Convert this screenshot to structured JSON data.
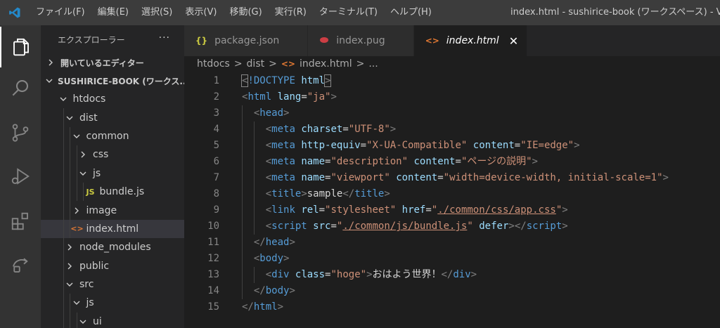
{
  "window": {
    "title": "index.html - sushirice-book (ワークスペース) - Visu"
  },
  "menu": [
    {
      "label": "ファイル(F)"
    },
    {
      "label": "編集(E)"
    },
    {
      "label": "選択(S)"
    },
    {
      "label": "表示(V)"
    },
    {
      "label": "移動(G)"
    },
    {
      "label": "実行(R)"
    },
    {
      "label": "ターミナル(T)"
    },
    {
      "label": "ヘルプ(H)"
    }
  ],
  "activitybar": [
    {
      "icon": "files-icon",
      "active": true
    },
    {
      "icon": "search-icon"
    },
    {
      "icon": "source-control-icon"
    },
    {
      "icon": "run-debug-icon"
    },
    {
      "icon": "extensions-icon"
    },
    {
      "icon": "remote-explorer-icon"
    }
  ],
  "explorer": {
    "title": "エクスプローラー",
    "more": "···",
    "sections": {
      "open_editors": "開いているエディター",
      "workspace": "SUSHIRICE-BOOK (ワークス..."
    },
    "tree": [
      {
        "label": "htdocs",
        "type": "folder",
        "expanded": true,
        "depth": 1
      },
      {
        "label": "dist",
        "type": "folder",
        "expanded": true,
        "depth": 2
      },
      {
        "label": "common",
        "type": "folder",
        "expanded": true,
        "depth": 3
      },
      {
        "label": "css",
        "type": "folder",
        "expanded": false,
        "depth": 4
      },
      {
        "label": "js",
        "type": "folder",
        "expanded": true,
        "depth": 4
      },
      {
        "label": "bundle.js",
        "type": "file",
        "icon": "JS",
        "depth": 5
      },
      {
        "label": "image",
        "type": "folder",
        "expanded": false,
        "depth": 3
      },
      {
        "label": "index.html",
        "type": "file",
        "icon": "<>",
        "depth": 3,
        "selected": true
      },
      {
        "label": "node_modules",
        "type": "folder",
        "expanded": false,
        "depth": 2
      },
      {
        "label": "public",
        "type": "folder",
        "expanded": false,
        "depth": 2
      },
      {
        "label": "src",
        "type": "folder",
        "expanded": true,
        "depth": 2
      },
      {
        "label": "js",
        "type": "folder",
        "expanded": true,
        "depth": 3
      },
      {
        "label": "ui",
        "type": "folder",
        "expanded": true,
        "depth": 4
      }
    ]
  },
  "tabs": [
    {
      "label": "package.json",
      "icon": "{}",
      "icon_color": "#cbcb41"
    },
    {
      "label": "index.pug",
      "icon": "pug",
      "icon_color": "#cc3e44"
    },
    {
      "label": "index.html",
      "icon": "<>",
      "icon_color": "#e37933",
      "active": true,
      "close": "✕"
    }
  ],
  "breadcrumb": {
    "parts": [
      "htdocs",
      "dist",
      "index.html",
      "..."
    ],
    "sep": ">"
  },
  "editor": {
    "lines": [
      {
        "n": "1",
        "indent": 0,
        "tokens": [
          [
            "brk",
            "<"
          ],
          [
            "tag",
            "!DOCTYPE"
          ],
          [
            "txt",
            " "
          ],
          [
            "attr",
            "html"
          ],
          [
            "brk",
            ">"
          ]
        ]
      },
      {
        "n": "2",
        "indent": 0,
        "tokens": [
          [
            "brk",
            "<"
          ],
          [
            "tag",
            "html"
          ],
          [
            "txt",
            " "
          ],
          [
            "attr",
            "lang"
          ],
          [
            "txt",
            "="
          ],
          [
            "str",
            "\"ja\""
          ],
          [
            "brk",
            ">"
          ]
        ]
      },
      {
        "n": "3",
        "indent": 1,
        "tokens": [
          [
            "brk",
            "<"
          ],
          [
            "tag",
            "head"
          ],
          [
            "brk",
            ">"
          ]
        ]
      },
      {
        "n": "4",
        "indent": 2,
        "tokens": [
          [
            "brk",
            "<"
          ],
          [
            "tag",
            "meta"
          ],
          [
            "txt",
            " "
          ],
          [
            "attr",
            "charset"
          ],
          [
            "txt",
            "="
          ],
          [
            "str",
            "\"UTF-8\""
          ],
          [
            "brk",
            ">"
          ]
        ]
      },
      {
        "n": "5",
        "indent": 2,
        "tokens": [
          [
            "brk",
            "<"
          ],
          [
            "tag",
            "meta"
          ],
          [
            "txt",
            " "
          ],
          [
            "attr",
            "http-equiv"
          ],
          [
            "txt",
            "="
          ],
          [
            "str",
            "\"X-UA-Compatible\""
          ],
          [
            "txt",
            " "
          ],
          [
            "attr",
            "content"
          ],
          [
            "txt",
            "="
          ],
          [
            "str",
            "\"IE=edge\""
          ],
          [
            "brk",
            ">"
          ]
        ]
      },
      {
        "n": "6",
        "indent": 2,
        "tokens": [
          [
            "brk",
            "<"
          ],
          [
            "tag",
            "meta"
          ],
          [
            "txt",
            " "
          ],
          [
            "attr",
            "name"
          ],
          [
            "txt",
            "="
          ],
          [
            "str",
            "\"description\""
          ],
          [
            "txt",
            " "
          ],
          [
            "attr",
            "content"
          ],
          [
            "txt",
            "="
          ],
          [
            "str",
            "\"ページの説明\""
          ],
          [
            "brk",
            ">"
          ]
        ]
      },
      {
        "n": "7",
        "indent": 2,
        "tokens": [
          [
            "brk",
            "<"
          ],
          [
            "tag",
            "meta"
          ],
          [
            "txt",
            " "
          ],
          [
            "attr",
            "name"
          ],
          [
            "txt",
            "="
          ],
          [
            "str",
            "\"viewport\""
          ],
          [
            "txt",
            " "
          ],
          [
            "attr",
            "content"
          ],
          [
            "txt",
            "="
          ],
          [
            "str",
            "\"width=device-width, initial-scale=1\""
          ],
          [
            "brk",
            ">"
          ]
        ]
      },
      {
        "n": "8",
        "indent": 2,
        "tokens": [
          [
            "brk",
            "<"
          ],
          [
            "tag",
            "title"
          ],
          [
            "brk",
            ">"
          ],
          [
            "txt",
            "sample"
          ],
          [
            "brk",
            "</"
          ],
          [
            "tag",
            "title"
          ],
          [
            "brk",
            ">"
          ]
        ]
      },
      {
        "n": "9",
        "indent": 2,
        "tokens": [
          [
            "brk",
            "<"
          ],
          [
            "tag",
            "link"
          ],
          [
            "txt",
            " "
          ],
          [
            "attr",
            "rel"
          ],
          [
            "txt",
            "="
          ],
          [
            "str",
            "\"stylesheet\""
          ],
          [
            "txt",
            " "
          ],
          [
            "attr",
            "href"
          ],
          [
            "txt",
            "="
          ],
          [
            "str",
            "\""
          ],
          [
            "strlink",
            "./common/css/app.css"
          ],
          [
            "str",
            "\""
          ],
          [
            "brk",
            ">"
          ]
        ]
      },
      {
        "n": "10",
        "indent": 2,
        "tokens": [
          [
            "brk",
            "<"
          ],
          [
            "tag",
            "script"
          ],
          [
            "txt",
            " "
          ],
          [
            "attr",
            "src"
          ],
          [
            "txt",
            "="
          ],
          [
            "str",
            "\""
          ],
          [
            "strlink",
            "./common/js/bundle.js"
          ],
          [
            "str",
            "\""
          ],
          [
            "txt",
            " "
          ],
          [
            "attr",
            "defer"
          ],
          [
            "brk",
            "></"
          ],
          [
            "tag",
            "script"
          ],
          [
            "brk",
            ">"
          ]
        ]
      },
      {
        "n": "11",
        "indent": 1,
        "tokens": [
          [
            "brk",
            "</"
          ],
          [
            "tag",
            "head"
          ],
          [
            "brk",
            ">"
          ]
        ]
      },
      {
        "n": "12",
        "indent": 1,
        "tokens": [
          [
            "brk",
            "<"
          ],
          [
            "tag",
            "body"
          ],
          [
            "brk",
            ">"
          ]
        ]
      },
      {
        "n": "13",
        "indent": 2,
        "tokens": [
          [
            "brk",
            "<"
          ],
          [
            "tag",
            "div"
          ],
          [
            "txt",
            " "
          ],
          [
            "attr",
            "class"
          ],
          [
            "txt",
            "="
          ],
          [
            "str",
            "\"hoge\""
          ],
          [
            "brk",
            ">"
          ],
          [
            "txt",
            "おはよう世界！"
          ],
          [
            "brk",
            "</"
          ],
          [
            "tag",
            "div"
          ],
          [
            "brk",
            ">"
          ]
        ]
      },
      {
        "n": "14",
        "indent": 1,
        "tokens": [
          [
            "brk",
            "</"
          ],
          [
            "tag",
            "body"
          ],
          [
            "brk",
            ">"
          ]
        ]
      },
      {
        "n": "15",
        "indent": 0,
        "tokens": [
          [
            "brk",
            "</"
          ],
          [
            "tag",
            "html"
          ],
          [
            "brk",
            ">"
          ]
        ]
      }
    ]
  },
  "colors": {
    "accent": "#007acc",
    "tag": "#569cd6",
    "attr": "#9cdcfe",
    "string": "#ce9178",
    "bracket": "#808080"
  }
}
